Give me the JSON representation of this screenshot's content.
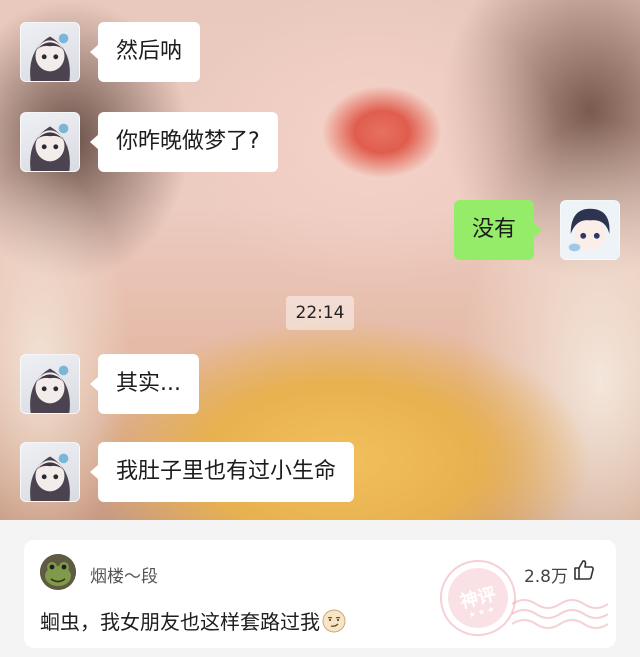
{
  "chat": {
    "messages": [
      {
        "side": "left",
        "text": "然后呐"
      },
      {
        "side": "left",
        "text": "你昨晚做梦了?"
      },
      {
        "side": "right",
        "text": "没有"
      },
      {
        "side": "left",
        "text": "其实..."
      },
      {
        "side": "left",
        "text": "我肚子里也有过小生命"
      }
    ],
    "timestamp": "22:14",
    "colors": {
      "incoming_bubble": "#ffffff",
      "outgoing_bubble": "#95ec69"
    }
  },
  "comment": {
    "username": "烟楼～段",
    "likes": "2.8万",
    "text": "蛔虫，我女朋友也这样套路过我",
    "avatar_icon": "frog-avatar",
    "like_icon": "thumbs-up-icon",
    "emoji": "smirk-face-emoji",
    "stamp": {
      "text": "神评",
      "dots": "★ ★ ★"
    }
  }
}
